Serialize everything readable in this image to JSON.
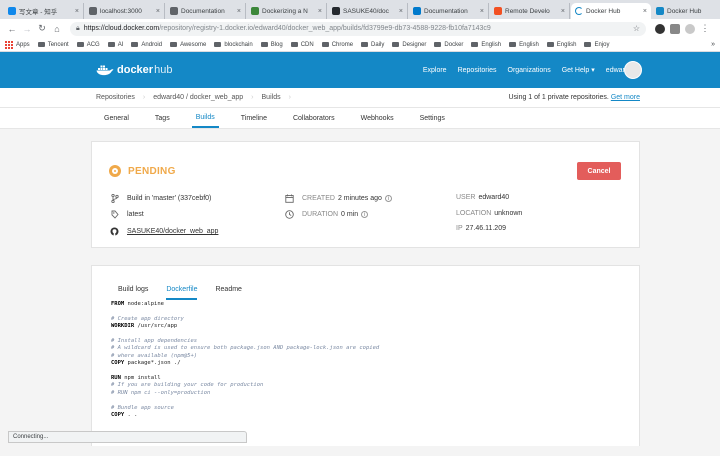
{
  "browser": {
    "tabs": [
      {
        "label": "写文章 - 知乎",
        "icon": "zhihu-icon",
        "color": "#0f88eb"
      },
      {
        "label": "localhost:3000",
        "icon": "globe-icon",
        "color": "#5f6368"
      },
      {
        "label": "Documentation",
        "icon": "globe-icon",
        "color": "#5f6368"
      },
      {
        "label": "Dockerizing a N",
        "icon": "node-icon",
        "color": "#3c873a"
      },
      {
        "label": "SASUKE40/doc",
        "icon": "github-icon",
        "color": "#24292e"
      },
      {
        "label": "Documentation",
        "icon": "vscode-icon",
        "color": "#007acc"
      },
      {
        "label": "Remote Develo",
        "icon": "windows-icon",
        "color": "#f25022"
      },
      {
        "label": "Docker Hub",
        "icon": "loading-icon",
        "color": "#1488c6"
      },
      {
        "label": "Docker Hub",
        "icon": "docker-icon",
        "color": "#1488c6"
      }
    ],
    "url_host": "https://cloud.docker.com",
    "url_path": "/repository/registry-1.docker.io/edward40/docker_web_app/builds/fd3799e9-db73-4588-9228-fb10fa7143c9",
    "bookmarks": [
      "Apps",
      "Tencent",
      "ACG",
      "AI",
      "Android",
      "Awesome",
      "blockchain",
      "Blog",
      "CDN",
      "Chrome",
      "Daily",
      "Designer",
      "Docker",
      "English",
      "English",
      "English",
      "Enjoy"
    ],
    "bookmarks_more": "»",
    "status_text": "Connecting..."
  },
  "header": {
    "logo_docker": "docker",
    "logo_hub": "hub",
    "nav": [
      "Explore",
      "Repositories",
      "Organizations",
      "Get Help ▾"
    ],
    "user": "edward40 ▾",
    "brand_color": "#1488c6"
  },
  "breadcrumb": {
    "items": [
      "Repositories",
      "edward40 / docker_web_app",
      "Builds"
    ],
    "private_text": "Using 1 of 1 private repositories.",
    "private_link": "Get more"
  },
  "tabs": [
    "General",
    "Tags",
    "Builds",
    "Timeline",
    "Collaborators",
    "Webhooks",
    "Settings"
  ],
  "active_tab": "Builds",
  "build": {
    "status": "PENDING",
    "status_color": "#f0a94a",
    "cancel_label": "Cancel",
    "branch_text": "Build in 'master' (337cebf0)",
    "tag": "latest",
    "repo_link": "SASUKE40/docker_web_app",
    "created_label": "CREATED",
    "created_value": "2 minutes ago",
    "duration_label": "DURATION",
    "duration_value": "0 min",
    "user_label": "USER",
    "user_value": "edward40",
    "location_label": "LOCATION",
    "location_value": "unknown",
    "ip_label": "IP",
    "ip_value": "27.46.11.209"
  },
  "logs": {
    "tabs": [
      "Build logs",
      "Dockerfile",
      "Readme"
    ],
    "active_tab": "Dockerfile",
    "lines": [
      {
        "k": "FROM",
        "t": " node:alpine"
      },
      {
        "t": ""
      },
      {
        "c": "# Create app directory"
      },
      {
        "k": "WORKDIR",
        "t": " /usr/src/app"
      },
      {
        "t": ""
      },
      {
        "c": "# Install app dependencies"
      },
      {
        "c": "# A wildcard is used to ensure both package.json AND package-lock.json are copied"
      },
      {
        "c": "# where available (npm@5+)"
      },
      {
        "k": "COPY",
        "t": " package*.json ./"
      },
      {
        "t": ""
      },
      {
        "k": "RUN",
        "t": " npm install"
      },
      {
        "c": "# If you are building your code for production"
      },
      {
        "c": "# RUN npm ci --only=production"
      },
      {
        "t": ""
      },
      {
        "c": "# Bundle app source"
      },
      {
        "k": "COPY",
        "t": " . ."
      }
    ]
  }
}
